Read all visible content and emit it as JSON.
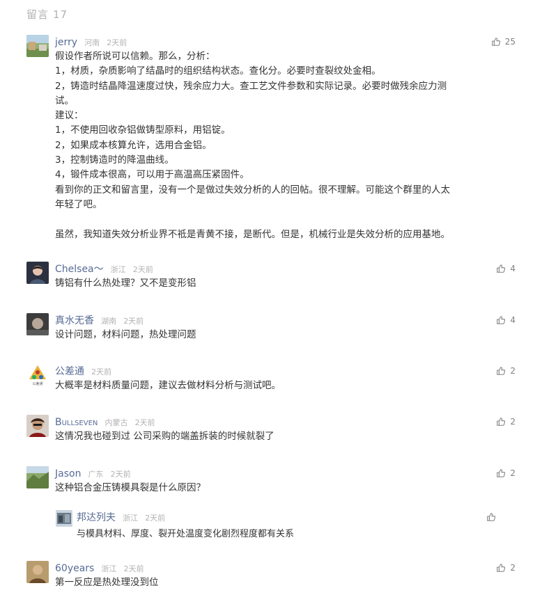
{
  "header": {
    "label": "留言",
    "count": "17"
  },
  "comments": [
    {
      "name": "jerry",
      "location": "河南",
      "time": "2天前",
      "likes": "25",
      "lines": [
        "假设作者所说可以信赖。那么，分析：",
        "1，材质，杂质影响了结晶时的组织结构状态。查化分。必要时查裂纹处金相。",
        "2，铸造时结晶降温速度过快，残余应力大。查工艺文件参数和实际记录。必要时做残余应力测",
        "试。",
        "建议：",
        "1，不使用回收杂铝做铸型原料，用铝锭。",
        "2，如果成本核算允许，选用合金铝。",
        "3，控制铸造时的降温曲线。",
        "4，锻件成本很高，可以用于高温高压紧固件。",
        "看到你的正文和留言里，没有一个是做过失效分析的人的回帖。很不理解。可能这个群里的人太",
        "年轻了吧。",
        "",
        "虽然，我知道失效分析业界不祗是青黄不接，是断代。但是，机械行业是失效分析的应用基地。"
      ]
    },
    {
      "name": "Chelsea～",
      "location": "浙江",
      "time": "2天前",
      "likes": "4",
      "lines": [
        "铸铝有什么热处理？又不是变形铝"
      ]
    },
    {
      "name": "真水无香",
      "location": "湖南",
      "time": "2天前",
      "likes": "4",
      "lines": [
        "设计问题，材料问题，热处理问题"
      ]
    },
    {
      "name": "公差通",
      "location": "",
      "time": "2天前",
      "likes": "2",
      "lines": [
        "大概率是材料质量问题，建议去做材料分析与测试吧。"
      ]
    },
    {
      "name": "Bullseven",
      "location": "内蒙古",
      "time": "2天前",
      "likes": "2",
      "lines": [
        "这情况我也碰到过 公司采购的端盖拆装的时候就裂了"
      ]
    },
    {
      "name": "Jason",
      "location": "广东",
      "time": "2天前",
      "likes": "2",
      "lines": [
        "这种铝合金压铸模具裂是什么原因？"
      ]
    },
    {
      "name": "60years",
      "location": "浙江",
      "time": "2天前",
      "likes": "2",
      "lines": [
        "第一反应是热处理没到位"
      ]
    }
  ],
  "reply": {
    "name": "邦达列夫",
    "location": "浙江",
    "time": "2天前",
    "text": "与模具材料、厚度、裂开处温度变化剧烈程度都有关系"
  },
  "logo_caption": "公差通"
}
